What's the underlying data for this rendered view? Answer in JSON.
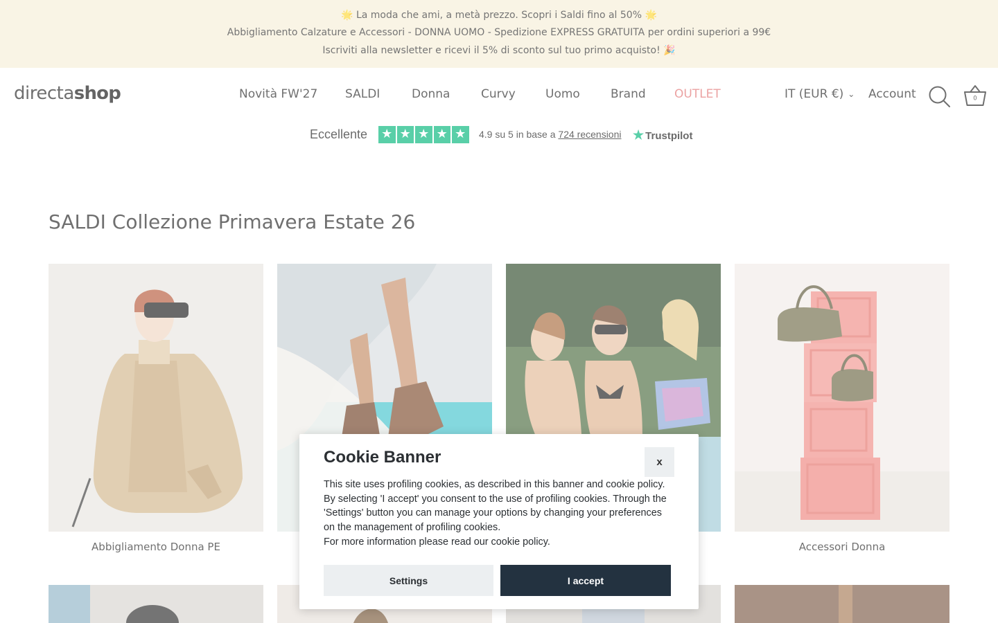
{
  "announcement": {
    "line1": "🌟 La moda che ami, a metà prezzo. Scopri i Saldi fino al 50% 🌟",
    "line2": "Abbigliamento Calzature e Accessori - DONNA UOMO - Spedizione EXPRESS GRATUITA per ordini superiori a 99€",
    "line3": "Iscriviti alla newsletter e ricevi il 5% di sconto sul tuo primo acquisto! 🎉"
  },
  "header": {
    "logo_light": "directa",
    "logo_bold": "shop",
    "nav": [
      "Novità FW'27",
      "SALDI",
      "Donna",
      "Curvy",
      "Uomo",
      "Brand",
      "OUTLET"
    ],
    "currency": "IT (EUR €)",
    "account": "Account",
    "cart_count": "0",
    "icons": {
      "search": "search-icon",
      "cart": "basket-icon",
      "currency": "chevron-down-icon"
    },
    "accent_color": "#e07070"
  },
  "trustpilot": {
    "label": "Eccellente",
    "rating_text": "4.9 su 5 in base a",
    "reviews_link": "724 recensioni",
    "brand": "Trustpilot",
    "stars": 5,
    "star_color": "#00b67a"
  },
  "main": {
    "title": "SALDI Collezione Primavera Estate 26",
    "tiles": [
      {
        "caption": "Abbigliamento Donna PE"
      },
      {
        "caption": ""
      },
      {
        "caption": ""
      },
      {
        "caption": "Accessori Donna"
      }
    ]
  },
  "cookie_banner": {
    "title": "Cookie Banner",
    "close": "x",
    "text": "This site uses profiling cookies, as described in this banner and cookie policy. By selecting 'I accept' you consent to the use of profiling cookies. Through the 'Settings' button you can manage your options by changing your preferences on the management of profiling cookies.",
    "text2": "For more information please read our cookie policy.",
    "settings": "Settings",
    "accept": "I accept",
    "accept_color": "#233240"
  }
}
